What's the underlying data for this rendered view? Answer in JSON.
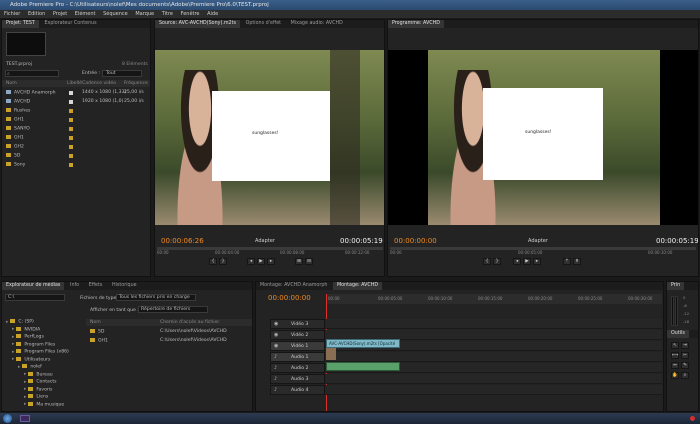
{
  "window": {
    "title": "Adobe Premiere Pro - C:\\Utilisateurs\\nolef\\Mes documents\\Adobe\\Premiere Pro\\6.0\\TEST.prproj",
    "menu": [
      "Fichier",
      "Edition",
      "Projet",
      "Elément",
      "Séquence",
      "Marque",
      "Titre",
      "Fenêtre",
      "Aide"
    ]
  },
  "project_panel": {
    "tabs": [
      "Projet: TEST",
      "Explorateur Contenus"
    ],
    "project_file": "TEST.prproj",
    "count": "8 Eléments",
    "search_placeholder": "",
    "entries_label": "Entrée :",
    "entries_value": "Tout",
    "columns": [
      "Nom",
      "Libellé",
      "Cadence vidéo",
      "Fréquence"
    ],
    "items": [
      {
        "name": "AVCHD Anamorph",
        "info": "1440 x 1080 (1,33)",
        "fps": "25,00 i/s",
        "type": "seq"
      },
      {
        "name": "AVCHD",
        "info": "1920 x 1080 (1,0)",
        "fps": "25,00 i/s",
        "type": "seq"
      },
      {
        "name": "Rushes",
        "info": "",
        "fps": "",
        "type": "folder"
      },
      {
        "name": "GH1",
        "info": "",
        "fps": "",
        "type": "folder"
      },
      {
        "name": "SANYO",
        "info": "",
        "fps": "",
        "type": "folder"
      },
      {
        "name": "GH1",
        "info": "",
        "fps": "",
        "type": "folder"
      },
      {
        "name": "GH2",
        "info": "",
        "fps": "",
        "type": "folder"
      },
      {
        "name": "5D",
        "info": "",
        "fps": "",
        "type": "folder"
      },
      {
        "name": "Sony",
        "info": "",
        "fps": "",
        "type": "folder"
      }
    ]
  },
  "source_monitor": {
    "tabs": [
      "Source: AVC-AVCHD(Sony).m2ts",
      "Options d'effet",
      "Mixage audio: AVCHD"
    ],
    "overlay_text": "sunglasses!",
    "timecode_in": "00:00:06:26",
    "fit_label": "Adapter",
    "duration": "00:00:05:19",
    "ruler": [
      "00:00",
      "00:00:04:00",
      "00:00:08:00",
      "00:00:12:00"
    ]
  },
  "program_monitor": {
    "tabs": [
      "Programme: AVCHD"
    ],
    "overlay_text": "sunglasses!",
    "timecode_in": "00:00:00:00",
    "fit_label": "Adapter",
    "duration": "00:00:05:19",
    "ruler": [
      "00:00",
      "00:00:05:00",
      "00:00:10:00"
    ]
  },
  "media_browser": {
    "tabs": [
      "Explorateur de médias",
      "Info",
      "Effets",
      "Historique"
    ],
    "drive": "C:\\",
    "file_types_label": "Fichiers de type :",
    "file_types_value": "Tous les fichiers pris en charge",
    "display_label": "Afficher en tant que :",
    "display_value": "Répertoire de fichiers",
    "tree": [
      {
        "label": "C: (SP)",
        "indent": 0
      },
      {
        "label": "NVIDIA",
        "indent": 1
      },
      {
        "label": "PerfLogs",
        "indent": 1
      },
      {
        "label": "Program Files",
        "indent": 1
      },
      {
        "label": "Program Files (x86)",
        "indent": 1
      },
      {
        "label": "Utilisateurs",
        "indent": 1
      },
      {
        "label": "nolef",
        "indent": 2
      },
      {
        "label": "Bureau",
        "indent": 3
      },
      {
        "label": "Contacts",
        "indent": 3
      },
      {
        "label": "Favoris",
        "indent": 3
      },
      {
        "label": "Liens",
        "indent": 3
      },
      {
        "label": "Ma musique",
        "indent": 3
      }
    ],
    "columns": [
      "Nom",
      "Chemin d'accès au fichier"
    ],
    "files": [
      {
        "name": "5D",
        "path": "C:\\Users\\nolef\\Videos\\AVCHD"
      },
      {
        "name": "GH1",
        "path": "C:\\Users\\nolef\\Videos\\AVCHD"
      }
    ]
  },
  "timeline": {
    "tabs": [
      "Montage: AVCHD Anamorph",
      "Montage: AVCHD"
    ],
    "timecode": "00:00:00:00",
    "ruler": [
      "00:00",
      "00:00:05:00",
      "00:00:10:00",
      "00:00:15:00",
      "00:00:20:00",
      "00:00:25:00",
      "00:00:30:00"
    ],
    "tracks": [
      {
        "name": "Vidéo 3"
      },
      {
        "name": "Vidéo 2"
      },
      {
        "name": "Vidéo 1"
      },
      {
        "name": "Audio 1"
      },
      {
        "name": "Audio 2"
      },
      {
        "name": "Audio 3"
      },
      {
        "name": "Audio 4"
      }
    ],
    "clip_label": "AVC-AVCHD(Sony).m2ts  [Opacité"
  },
  "audio_meter": {
    "tabs": [
      "Prin",
      "Outils"
    ],
    "scale": [
      "0",
      "-6",
      "-12",
      "-18",
      "-24",
      "-30",
      "-36",
      "-42",
      "-48",
      "-54"
    ]
  },
  "colors": {
    "accent_orange": "#f08a24",
    "timecode_blue": "#4a8cd8",
    "clip_video": "#7fb8c8",
    "clip_audio": "#5aa06a"
  }
}
